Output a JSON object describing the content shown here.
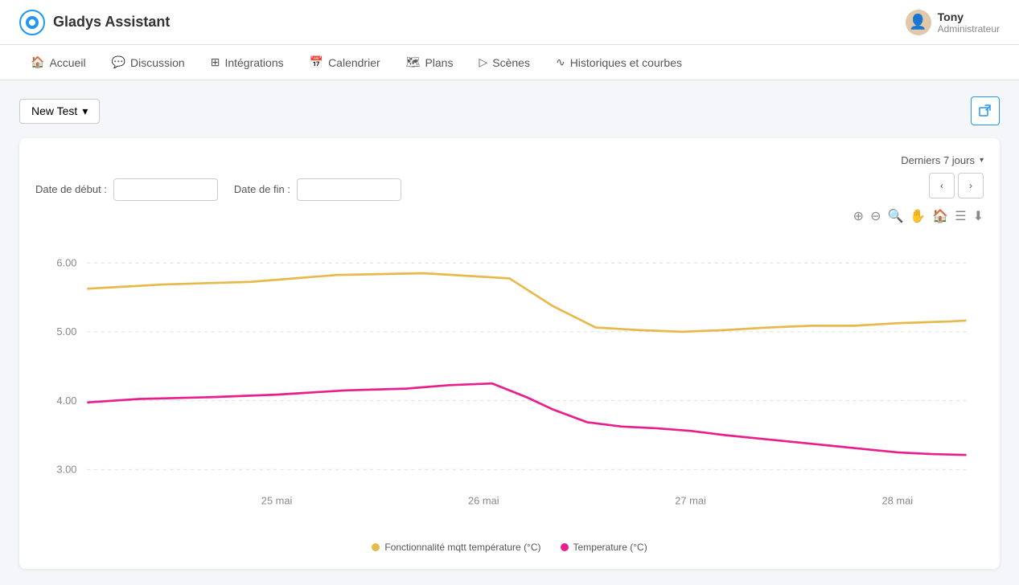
{
  "header": {
    "logo_alt": "Gladys Assistant logo",
    "app_title": "Gladys Assistant",
    "user_name": "Tony",
    "user_role": "Administrateur"
  },
  "nav": {
    "items": [
      {
        "label": "Accueil",
        "icon": "🏠"
      },
      {
        "label": "Discussion",
        "icon": "💬"
      },
      {
        "label": "Intégrations",
        "icon": "⊞"
      },
      {
        "label": "Calendrier",
        "icon": "📅"
      },
      {
        "label": "Plans",
        "icon": "🗺"
      },
      {
        "label": "Scènes",
        "icon": "▷"
      },
      {
        "label": "Historiques et courbes",
        "icon": "∿"
      }
    ]
  },
  "toolbar": {
    "new_test_label": "New Test",
    "caret": "▾",
    "export_icon": "⬡"
  },
  "chart": {
    "date_start_label": "Date de début :",
    "date_end_label": "Date de fin :",
    "period_label": "Derniers 7 jours",
    "prev_label": "‹",
    "next_label": "›",
    "x_labels": [
      "25 mai",
      "26 mai",
      "27 mai",
      "28 mai"
    ],
    "y_labels": [
      "6.00",
      "5.00",
      "4.00",
      "3.00"
    ],
    "legend": [
      {
        "label": "Fonctionnalité mqtt température (°C)",
        "color": "#e8b84b"
      },
      {
        "label": "Temperature (°C)",
        "color": "#e91e8c"
      }
    ]
  }
}
